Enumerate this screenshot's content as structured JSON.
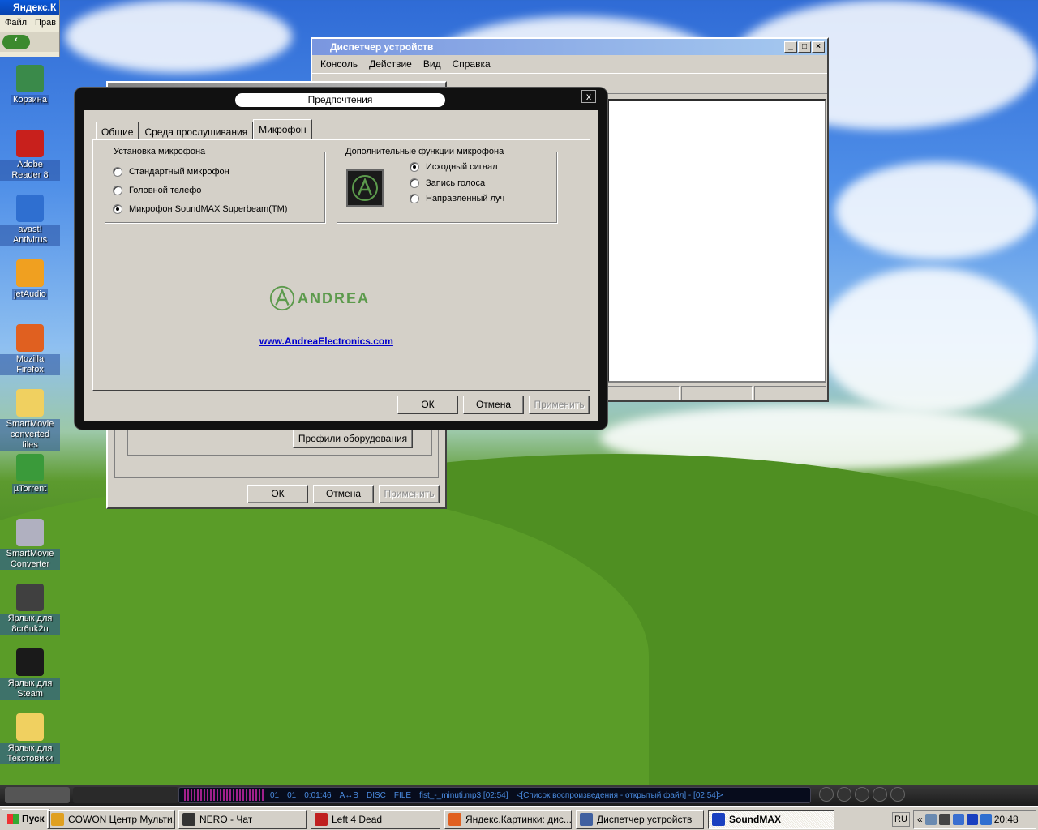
{
  "firefox_fragment": {
    "title": "Яндекс.К",
    "menu": [
      "Файл",
      "Прав"
    ]
  },
  "desktop_icons": [
    {
      "label": "Корзина",
      "icon": "recycle-bin-icon",
      "color": "#3a8a4a"
    },
    {
      "label": "Adobe Reader 8",
      "icon": "adobe-reader-icon",
      "color": "#c8201c"
    },
    {
      "label": "avast! Antivirus",
      "icon": "avast-icon",
      "color": "#2f6fd0"
    },
    {
      "label": "jetAudio",
      "icon": "jetaudio-icon",
      "color": "#f0a020"
    },
    {
      "label": "Mozilla Firefox",
      "icon": "firefox-icon",
      "color": "#e06020"
    },
    {
      "label": "SmartMovie converted files",
      "icon": "folder-icon",
      "color": "#f0d060"
    },
    {
      "label": "µTorrent",
      "icon": "utorrent-icon",
      "color": "#3a9a3a"
    },
    {
      "label": "SmartMovie Converter",
      "icon": "smartmovie-icon",
      "color": "#b0b0c0"
    },
    {
      "label": "Ярлык для 8cr6uk2n",
      "icon": "spider-icon",
      "color": "#404040"
    },
    {
      "label": "Ярлык для Steam",
      "icon": "steam-icon",
      "color": "#1a1a1a"
    },
    {
      "label": "Ярлык для Текстовики",
      "icon": "folder-icon",
      "color": "#f0d060"
    }
  ],
  "device_manager": {
    "title": "Диспетчер устройств",
    "menu": [
      "Консоль",
      "Действие",
      "Вид",
      "Справка"
    ]
  },
  "system_properties": {
    "hardware_profiles_button": "Профили оборудования",
    "ok": "ОК",
    "cancel": "Отмена",
    "apply": "Применить"
  },
  "preferences": {
    "title": "Предпочтения",
    "close": "x",
    "tabs": [
      "Общие",
      "Среда прослушивания",
      "Микрофон"
    ],
    "active_tab": "Микрофон",
    "mic_setup": {
      "legend": "Установка микрофона",
      "options": [
        "Стандартный микрофон",
        "Головной телефо",
        "Микрофон SoundMAX Superbeam(TM)"
      ],
      "selected": 2
    },
    "mic_extra": {
      "legend": "Дополнительные функции микрофона",
      "options": [
        "Исходный сигнал",
        "Запись голоса",
        "Направленный луч"
      ],
      "selected": 0
    },
    "logo_text": "ANDREA",
    "link": "www.AndreaElectronics.com",
    "ok": "ОК",
    "cancel": "Отмена",
    "apply": "Применить"
  },
  "player": {
    "track": "01",
    "index": "01",
    "time": "0:01:46",
    "ab": "A↔B",
    "disc": "DISC",
    "file": "FILE",
    "now_playing": "fist_-_minuti.mp3  [02:54]",
    "playlist": "<[Список воспроизведения - открытый файл] - [02:54]>"
  },
  "taskbar": {
    "start": "Пуск",
    "tasks": [
      {
        "label": "COWON Центр Мульти...",
        "color": "#e0a020"
      },
      {
        "label": "NERO - Чат",
        "color": "#333333"
      },
      {
        "label": "Left 4 Dead",
        "color": "#c02020"
      },
      {
        "label": "Яндекс.Картинки: дис...",
        "color": "#e06020"
      },
      {
        "label": "Диспетчер устройств",
        "color": "#4060a0"
      },
      {
        "label": "SoundMAX",
        "color": "#1a40c0"
      }
    ],
    "active_task": 5,
    "language": "RU",
    "clock": "20:48"
  }
}
